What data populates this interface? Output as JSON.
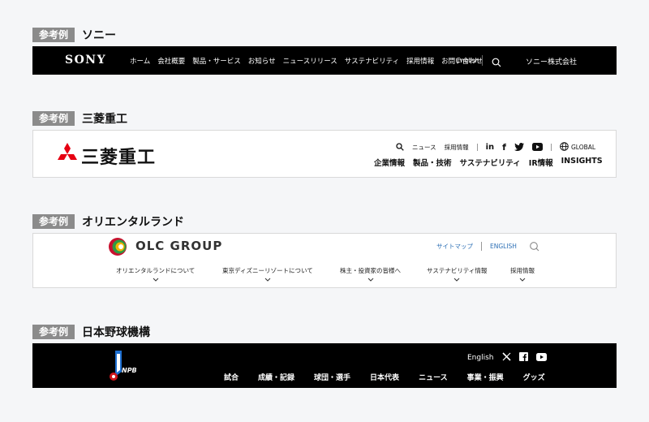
{
  "example_tag": "参考例",
  "sony": {
    "title": "ソニー",
    "logo": "SONY",
    "nav": [
      "ホーム",
      "会社概要",
      "製品・サービス",
      "お知らせ",
      "ニュースリリース",
      "サステナビリティ",
      "採用情報",
      "お問い合わせ"
    ],
    "language": "English",
    "corporate": "ソニー株式会社"
  },
  "mhi": {
    "title": "三菱重工",
    "logo": "三菱重工",
    "utility": [
      "ニュース",
      "採用情報"
    ],
    "global": "GLOBAL",
    "nav": [
      "企業情報",
      "製品・技術",
      "サステナビリティ",
      "IR情報",
      "INSIGHTS"
    ]
  },
  "olc": {
    "title": "オリエンタルランド",
    "logo": "OLC GROUP",
    "sitemap": "サイトマップ",
    "english": "ENGLISH",
    "nav": [
      "オリエンタルランドについて",
      "東京ディズニーリゾートについて",
      "株主・投資家の皆様へ",
      "サステナビリティ情報",
      "採用情報"
    ]
  },
  "npb": {
    "title": "日本野球機構",
    "logo": "NPB",
    "language": "English",
    "nav": [
      "試合",
      "成績・記録",
      "球団・選手",
      "日本代表",
      "ニュース",
      "事業・振興",
      "グッズ"
    ]
  }
}
